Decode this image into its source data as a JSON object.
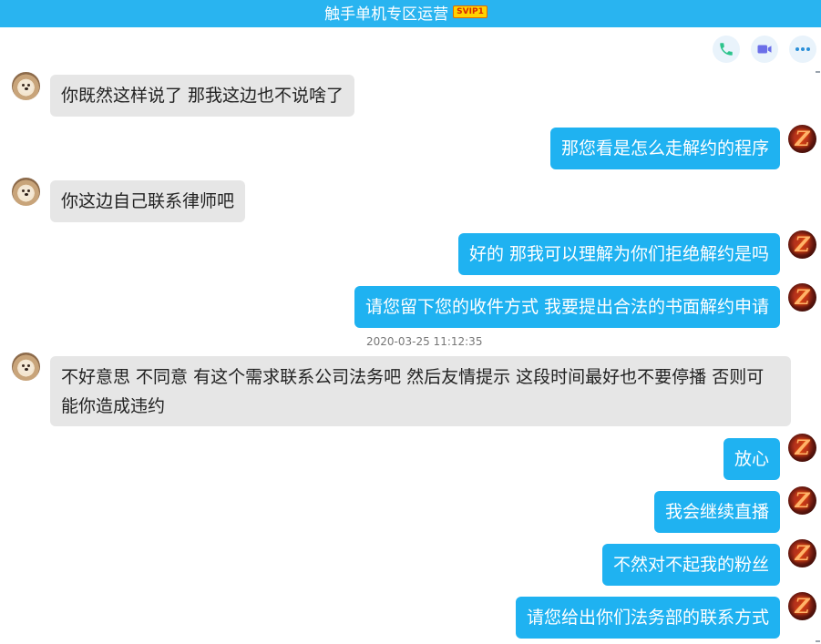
{
  "header": {
    "title": "触手单机专区运营",
    "vip_badge": "SVIP1"
  },
  "actions": [
    {
      "name": "voice-call-button",
      "icon": "phone-icon"
    },
    {
      "name": "video-call-button",
      "icon": "video-camera-icon"
    },
    {
      "name": "more-button",
      "icon": "more-dots-icon"
    }
  ],
  "colors": {
    "titlebar": "#29b4f0",
    "incoming_bubble": "#e6e6e6",
    "outgoing_bubble": "#1fb2f1"
  },
  "messages": [
    {
      "direction": "in",
      "text": "你既然这样说了 那我这边也不说啥了"
    },
    {
      "direction": "out",
      "text": "那您看是怎么走解约的程序"
    },
    {
      "direction": "in",
      "text": "你这边自己联系律师吧"
    },
    {
      "direction": "out",
      "text": "好的 那我可以理解为你们拒绝解约是吗"
    },
    {
      "direction": "out",
      "text": "请您留下您的收件方式 我要提出合法的书面解约申请"
    },
    {
      "direction": "timestamp",
      "text": "2020-03-25 11:12:35"
    },
    {
      "direction": "in",
      "text": "不好意思 不同意 有这个需求联系公司法务吧 然后友情提示 这段时间最好也不要停播 否则可能你造成违约"
    },
    {
      "direction": "out",
      "text": "放心"
    },
    {
      "direction": "out",
      "text": "我会继续直播"
    },
    {
      "direction": "out",
      "text": "不然对不起我的粉丝"
    },
    {
      "direction": "out",
      "text": "请您给出你们法务部的联系方式"
    }
  ]
}
